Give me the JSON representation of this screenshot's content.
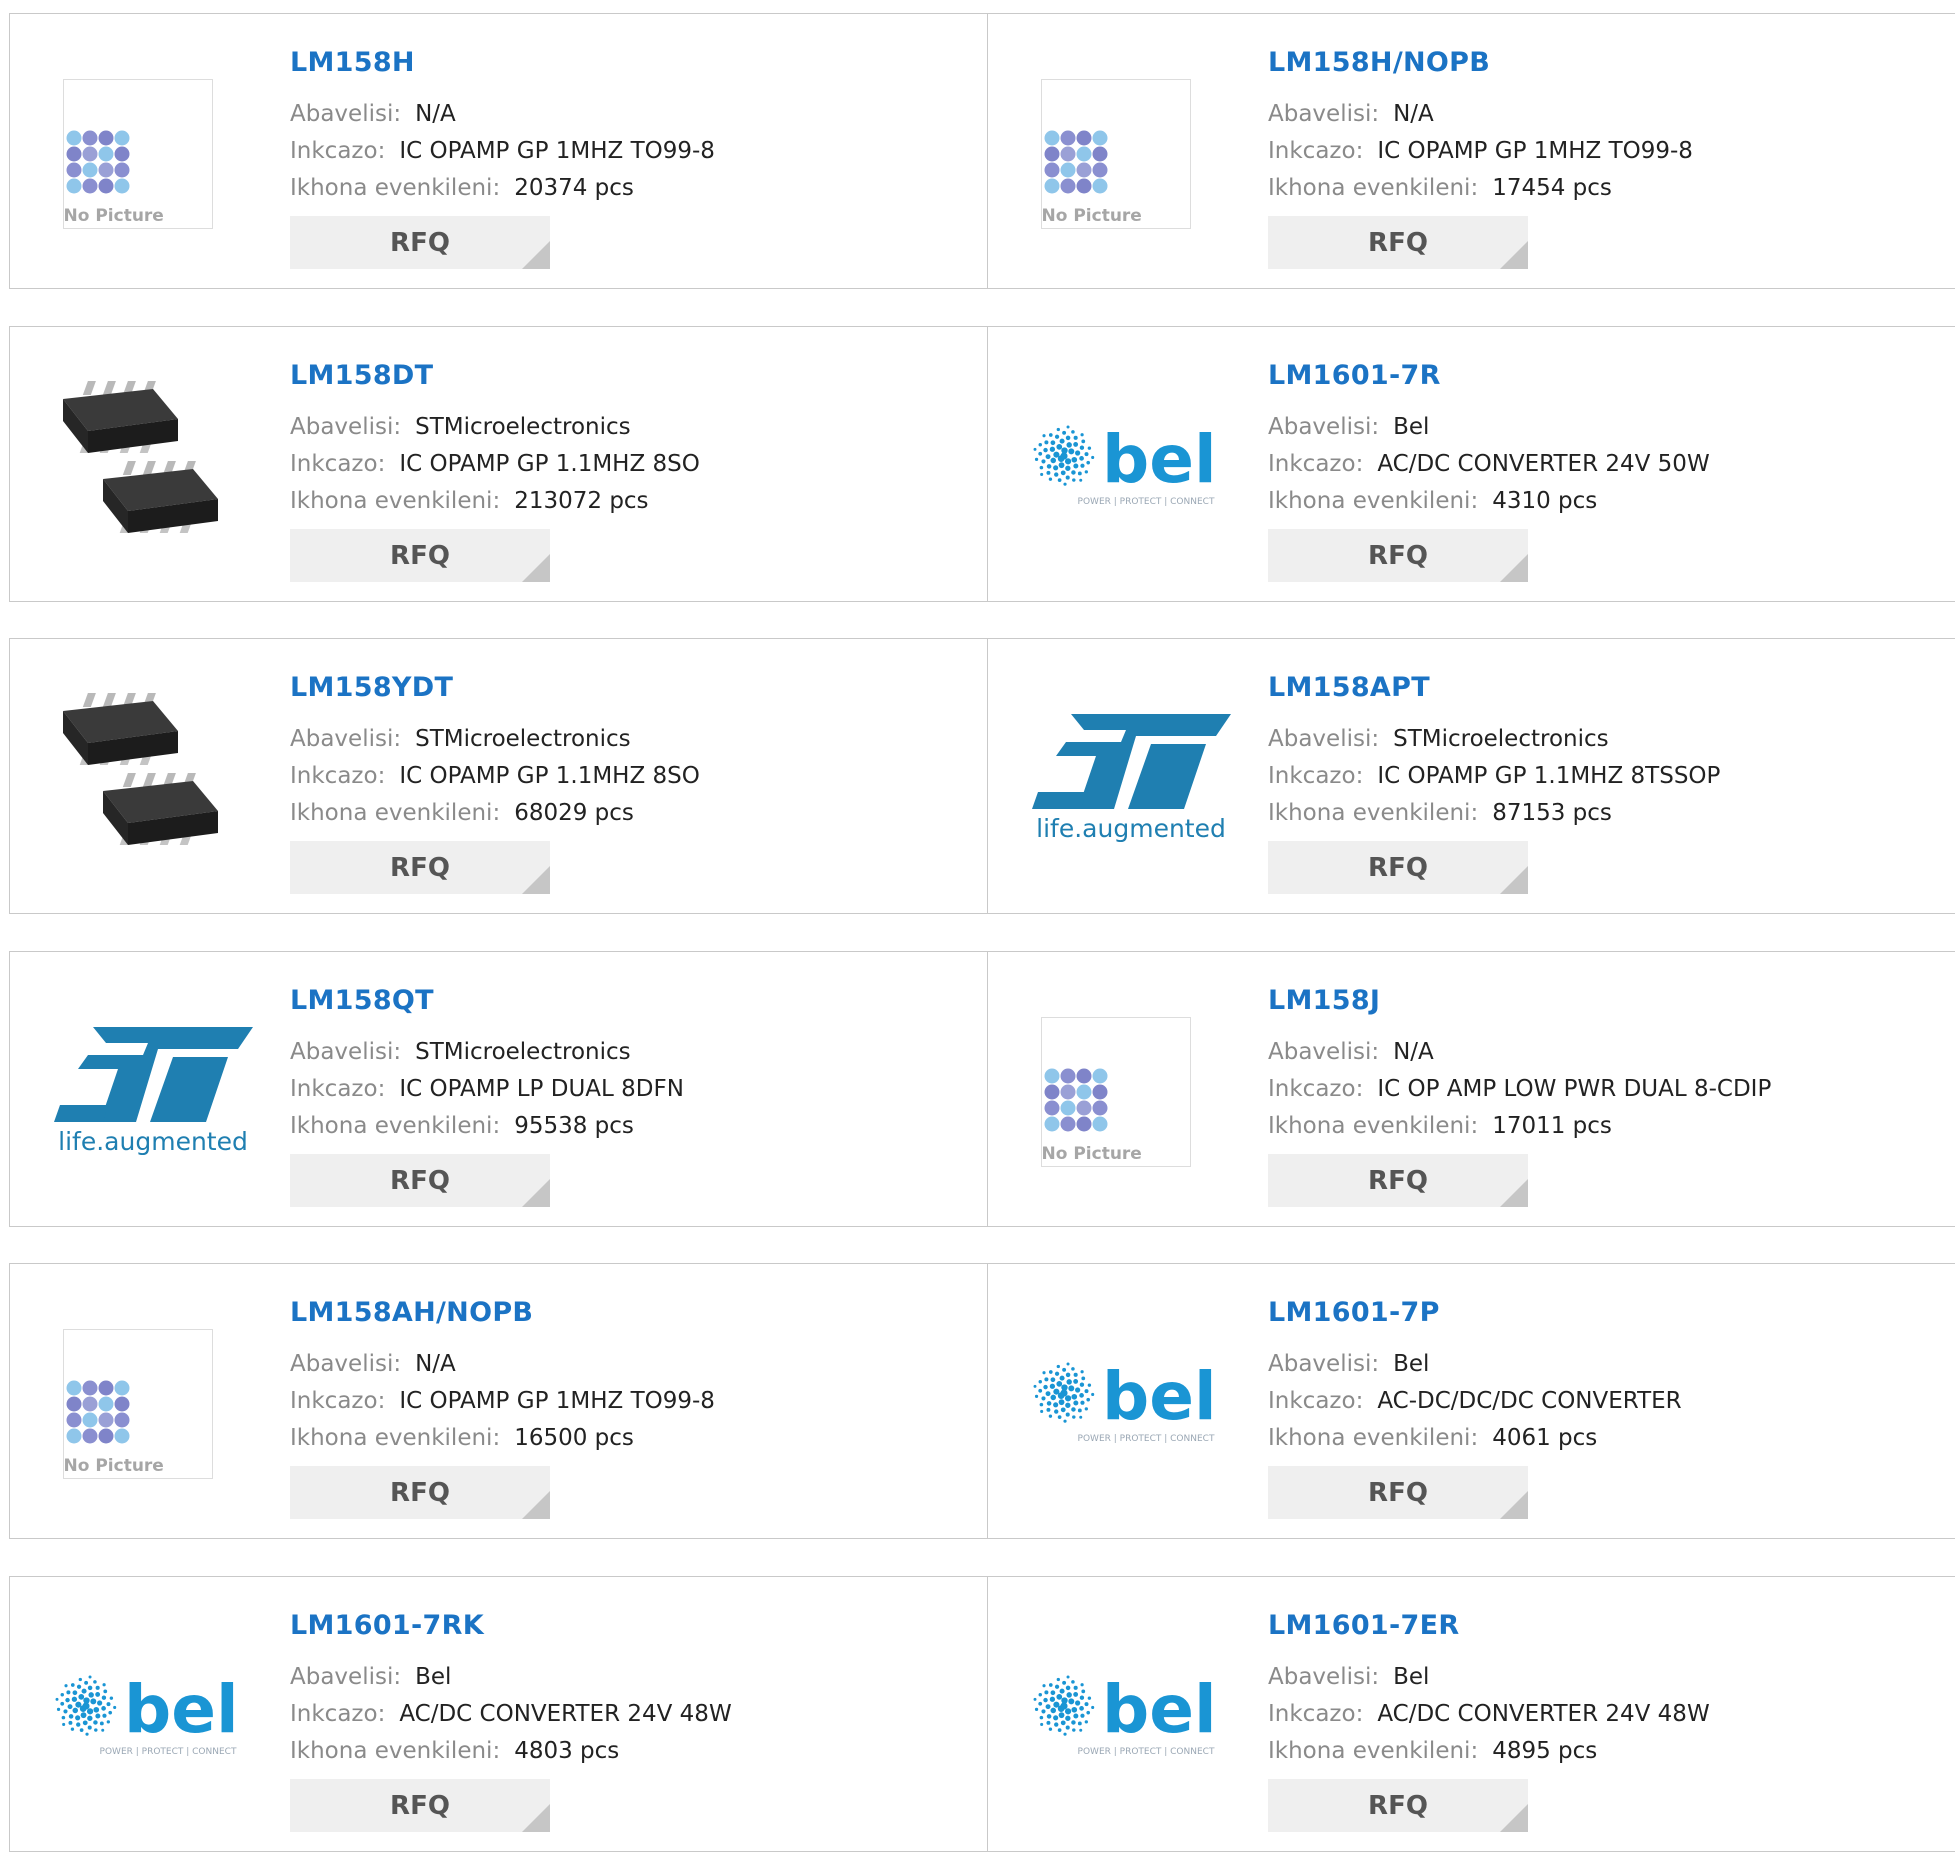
{
  "labels": {
    "manufacturer": "Abavelisi:",
    "description": "Inkcazo:",
    "stock": "Ikhona evenkileni:",
    "rfq": "RFQ",
    "no_picture": "No Picture"
  },
  "products": [
    {
      "part": "LM158H",
      "manufacturer": "N/A",
      "description": "IC OPAMP GP 1MHZ TO99-8",
      "stock": "20374 pcs",
      "image": "no-picture"
    },
    {
      "part": "LM158H/NOPB",
      "manufacturer": "N/A",
      "description": "IC OPAMP GP 1MHZ TO99-8",
      "stock": "17454 pcs",
      "image": "no-picture"
    },
    {
      "part": "LM158DT",
      "manufacturer": "STMicroelectronics",
      "description": "IC OPAMP GP 1.1MHZ 8SO",
      "stock": "213072 pcs",
      "image": "chip"
    },
    {
      "part": "LM1601-7R",
      "manufacturer": "Bel",
      "description": "AC/DC CONVERTER 24V 50W",
      "stock": "4310 pcs",
      "image": "bel-logo"
    },
    {
      "part": "LM158YDT",
      "manufacturer": "STMicroelectronics",
      "description": "IC OPAMP GP 1.1MHZ 8SO",
      "stock": "68029 pcs",
      "image": "chip"
    },
    {
      "part": "LM158APT",
      "manufacturer": "STMicroelectronics",
      "description": "IC OPAMP GP 1.1MHZ 8TSSOP",
      "stock": "87153 pcs",
      "image": "st-logo"
    },
    {
      "part": "LM158QT",
      "manufacturer": "STMicroelectronics",
      "description": "IC OPAMP LP DUAL 8DFN",
      "stock": "95538 pcs",
      "image": "st-logo"
    },
    {
      "part": "LM158J",
      "manufacturer": "N/A",
      "description": "IC OP AMP LOW PWR DUAL 8-CDIP",
      "stock": "17011 pcs",
      "image": "no-picture"
    },
    {
      "part": "LM158AH/NOPB",
      "manufacturer": "N/A",
      "description": "IC OPAMP GP 1MHZ TO99-8",
      "stock": "16500 pcs",
      "image": "no-picture"
    },
    {
      "part": "LM1601-7P",
      "manufacturer": "Bel",
      "description": "AC-DC/DC/DC CONVERTER",
      "stock": "4061 pcs",
      "image": "bel-logo"
    },
    {
      "part": "LM1601-7RK",
      "manufacturer": "Bel",
      "description": "AC/DC CONVERTER 24V 48W",
      "stock": "4803 pcs",
      "image": "bel-logo"
    },
    {
      "part": "LM1601-7ER",
      "manufacturer": "Bel",
      "description": "AC/DC CONVERTER 24V 48W",
      "stock": "4895 pcs",
      "image": "bel-logo"
    }
  ],
  "logos": {
    "st_tagline": "life.augmented",
    "bel_wordmark": "bel",
    "bel_tagline": "POWER | PROTECT | CONNECT"
  },
  "colors": {
    "part_link": "#1b73c4",
    "label": "#8a8a8a",
    "value": "#222222",
    "rfq_bg": "#efefef",
    "st_blue": "#1f7fb1",
    "bel_blue": "#1a95d4"
  }
}
